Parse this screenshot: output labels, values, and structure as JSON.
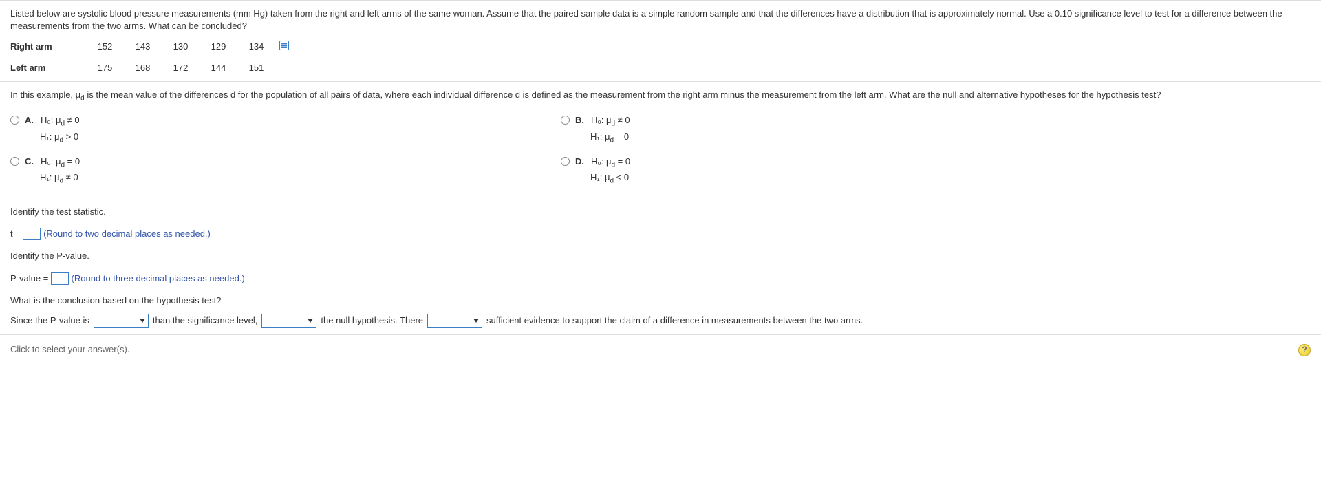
{
  "intro": "Listed below are systolic blood pressure measurements (mm Hg) taken from the right and left arms of the same woman. Assume that the paired sample data is a simple random sample and that the differences have a distribution that is approximately normal. Use a 0.10 significance level to test for a difference between the measurements from the two arms. What can be concluded?",
  "table": {
    "row1_label": "Right arm",
    "row1": [
      "152",
      "143",
      "130",
      "129",
      "134"
    ],
    "row2_label": "Left arm",
    "row2": [
      "175",
      "168",
      "172",
      "144",
      "151"
    ]
  },
  "hypo_question_pre": "In this example, ",
  "hypo_mu": "μ",
  "hypo_sub_d": "d",
  "hypo_question_post": " is the mean value of the differences d for the population of all pairs of data, where each individual difference d is defined as the measurement from the right arm minus the measurement from the left arm. What are the null and alternative hypotheses for the hypothesis test?",
  "options": {
    "A": {
      "label": "A.",
      "h0": "H₀: μ",
      "h0_rel": " ≠ 0",
      "h1": "H₁: μ",
      "h1_rel": " > 0"
    },
    "B": {
      "label": "B.",
      "h0": "H₀: μ",
      "h0_rel": " ≠ 0",
      "h1": "H₁: μ",
      "h1_rel": " = 0"
    },
    "C": {
      "label": "C.",
      "h0": "H₀: μ",
      "h0_rel": " = 0",
      "h1": "H₁: μ",
      "h1_rel": " ≠ 0"
    },
    "D": {
      "label": "D.",
      "h0": "H₀: μ",
      "h0_rel": " = 0",
      "h1": "H₁: μ",
      "h1_rel": " < 0"
    }
  },
  "identify_stat": "Identify the test statistic.",
  "t_prefix": "t = ",
  "t_hint": "(Round to two decimal places as needed.)",
  "identify_p": "Identify the P-value.",
  "p_prefix": "P-value = ",
  "p_hint": "(Round to three decimal places as needed.)",
  "conclusion_q": "What is the conclusion based on the hypothesis test?",
  "concl": {
    "p1": "Since the P-value is",
    "p2": "than the significance level,",
    "p3": "the null hypothesis. There",
    "p4": "sufficient evidence to support the claim of a difference in measurements between the two arms."
  },
  "footer_text": "Click to select your answer(s).",
  "help": "?"
}
